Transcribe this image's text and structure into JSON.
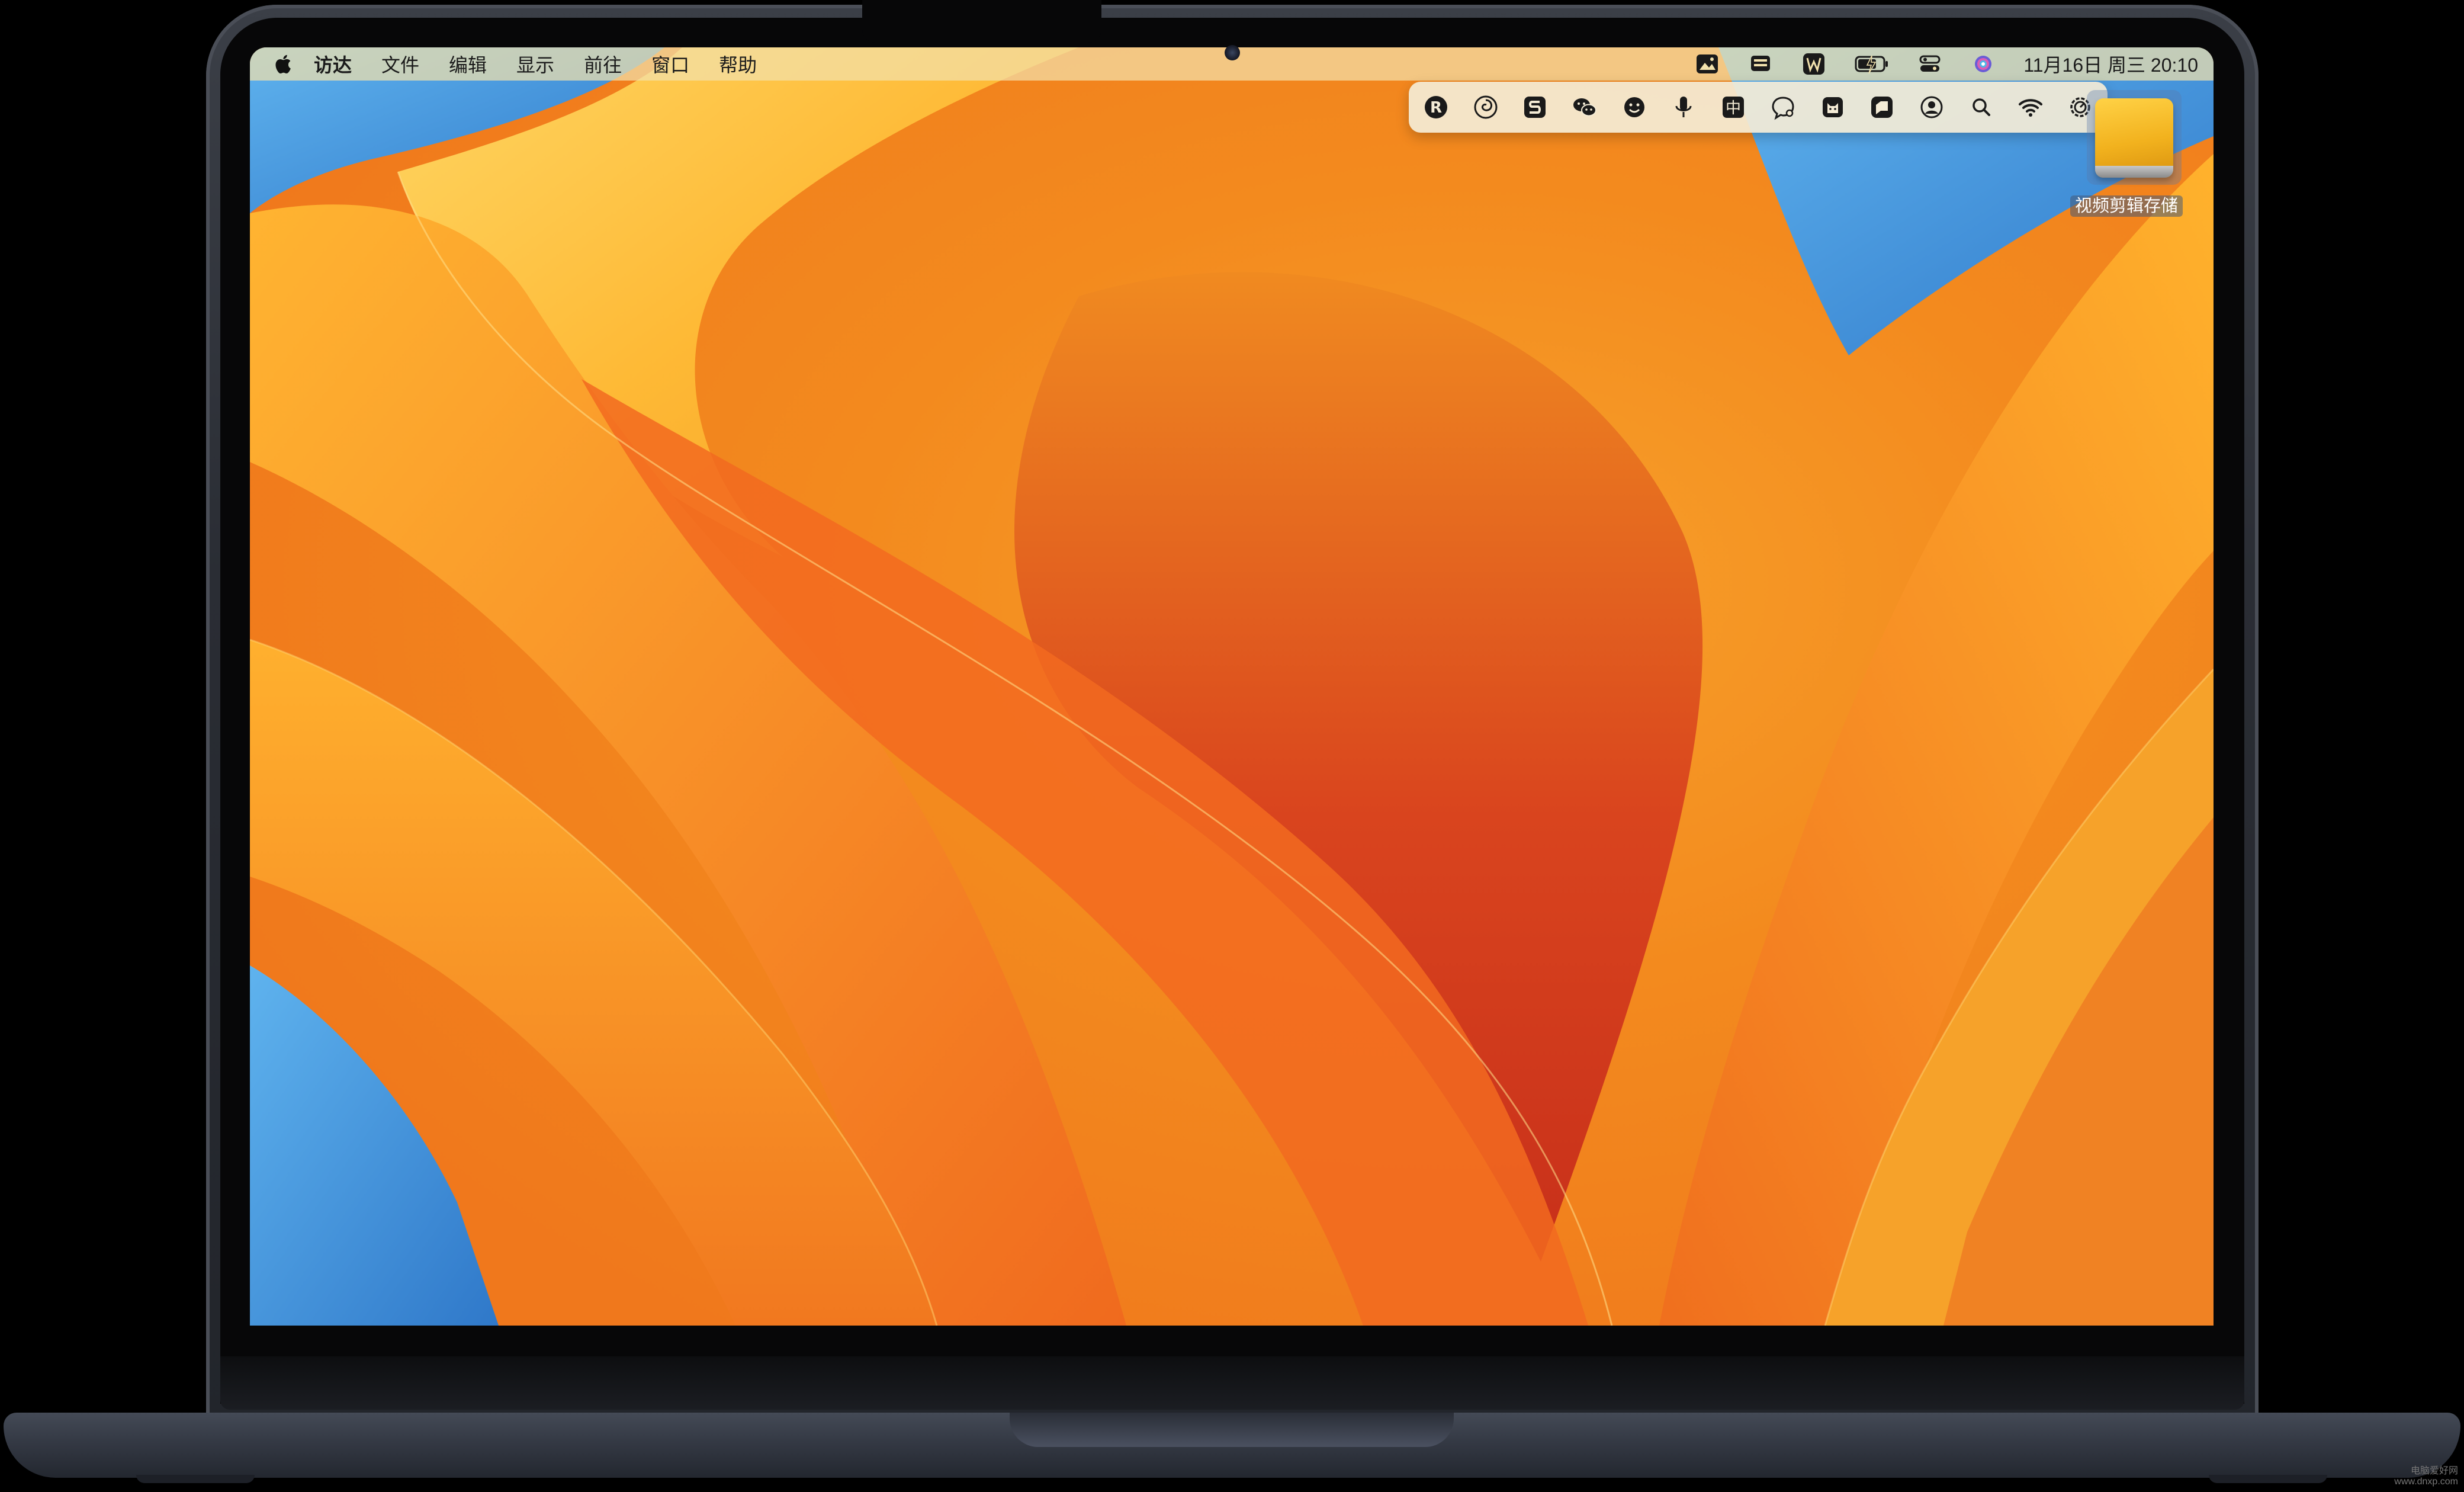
{
  "menubar": {
    "apple_icon": "apple-logo-icon",
    "items": [
      {
        "label": "访达",
        "bold": true
      },
      {
        "label": "文件"
      },
      {
        "label": "编辑"
      },
      {
        "label": "显示"
      },
      {
        "label": "前往"
      },
      {
        "label": "窗口"
      },
      {
        "label": "帮助"
      }
    ],
    "status_icons": [
      "photo-icon",
      "display-icon",
      "w-app-icon",
      "battery-charging-icon",
      "control-center-icon",
      "siri-icon"
    ],
    "clock": "11月16日 周三  20:10"
  },
  "iconbar": {
    "icons": [
      "r-app-icon",
      "spiral-app-icon",
      "s-app-icon",
      "wechat-icon",
      "smiley-icon",
      "microphone-icon",
      "chinese-input-icon",
      "chat-search-icon",
      "cat-app-icon",
      "speech-app-icon",
      "user-account-icon",
      "search-icon",
      "wifi-icon",
      "settings-icon"
    ],
    "input_char": "中"
  },
  "desktop": {
    "drive_label": "视频剪辑存储",
    "drive_icon": "external-drive-icon"
  },
  "colors": {
    "wallpaper_orange": "#f28a1e",
    "wallpaper_yellow": "#ffd34a",
    "wallpaper_red": "#d6381e",
    "wallpaper_blue": "#3f8ed8",
    "laptop_body": "#2a2d34"
  },
  "watermark": {
    "line1": "电脑爱好网",
    "line2": "www.dnxp.com"
  }
}
